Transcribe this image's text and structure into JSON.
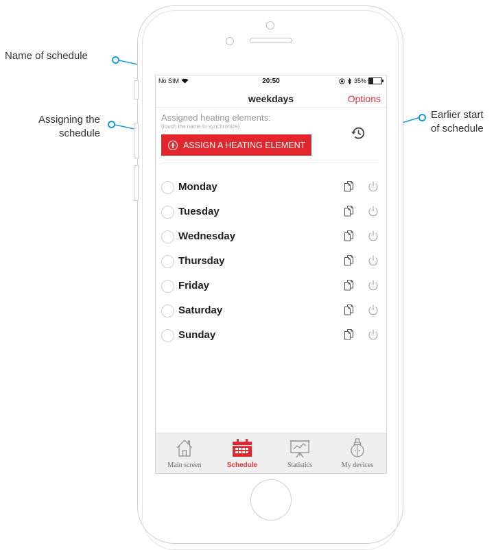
{
  "annotations": {
    "schedule_name": "Name of schedule",
    "assigning": [
      "Assigning the",
      "schedule"
    ],
    "earlier_start": [
      "Earlier start",
      "of schedule"
    ]
  },
  "status_bar": {
    "carrier": "No SIM",
    "time": "20:50",
    "battery": "35%",
    "battery_level": 0.35
  },
  "nav": {
    "title": "weekdays",
    "options": "Options"
  },
  "assigned": {
    "label": "Assigned heating elements:",
    "hint": "(touch the name to synchronize)",
    "button": "ASSIGN A HEATING ELEMENT"
  },
  "days": [
    {
      "name": "Monday"
    },
    {
      "name": "Tuesday"
    },
    {
      "name": "Wednesday"
    },
    {
      "name": "Thursday"
    },
    {
      "name": "Friday"
    },
    {
      "name": "Saturday"
    },
    {
      "name": "Sunday"
    }
  ],
  "tabs": [
    {
      "label": "Main screen",
      "icon": "house-icon",
      "active": false
    },
    {
      "label": "Schedule",
      "icon": "calendar-icon",
      "active": true
    },
    {
      "label": "Statistics",
      "icon": "chart-board-icon",
      "active": false
    },
    {
      "label": "My devices",
      "icon": "radiator-device-icon",
      "active": false
    }
  ],
  "colors": {
    "accent": "#e3262d",
    "annotation": "#1a9bd7"
  }
}
